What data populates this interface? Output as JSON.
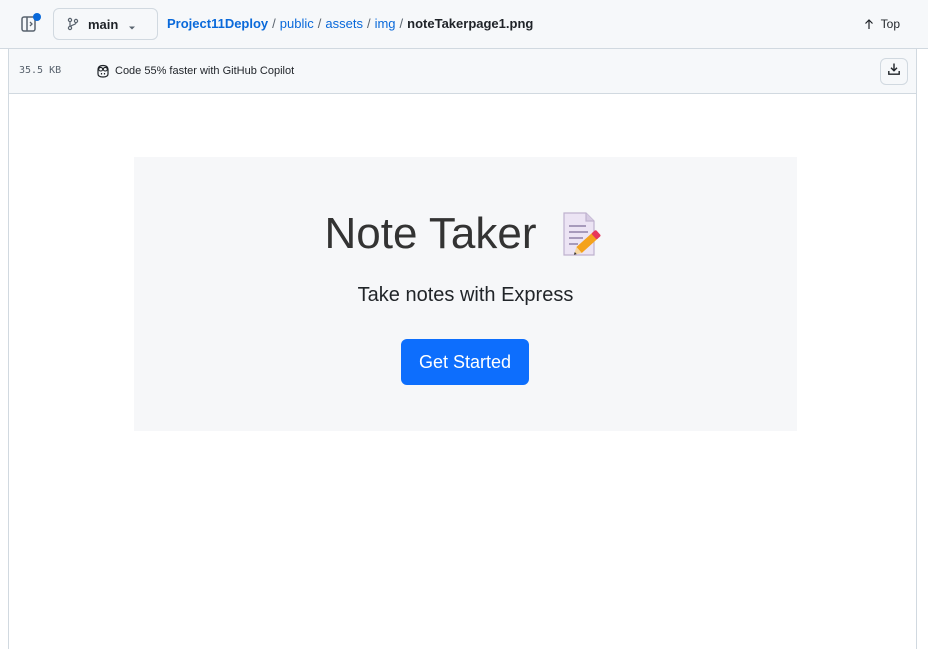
{
  "header": {
    "branch": "main",
    "breadcrumb": {
      "repo": "Project11Deploy",
      "dirs": [
        "public",
        "assets",
        "img"
      ],
      "separator": "/",
      "file": "noteTakerpage1.png"
    },
    "top_label": "Top"
  },
  "filebar": {
    "size": "35.5 KB",
    "copilot_text": "Code 55% faster with GitHub Copilot",
    "download_icon": "download-icon"
  },
  "preview": {
    "title": "Note Taker",
    "title_icon": "memo-icon",
    "subtitle": "Take notes with Express",
    "button": "Get Started"
  },
  "colors": {
    "link": "#0969da",
    "primary_button": "#0d6efd",
    "jumbotron_bg": "#f6f7f9",
    "bar_bg": "#f6f8fa",
    "border": "#d1d9e0"
  }
}
